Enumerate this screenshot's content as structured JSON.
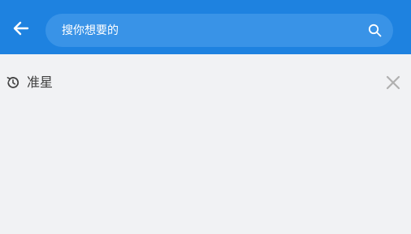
{
  "colors": {
    "header_bg": "#1e82e0",
    "search_bg": "#3993e7",
    "page_bg": "#f1f2f4",
    "text": "#3d3d3d",
    "icon_gray": "#b0b0b0"
  },
  "header": {
    "back_icon": "arrow-left-icon",
    "search": {
      "placeholder": "搜你想要的",
      "value": "",
      "icon": "search-icon"
    }
  },
  "history": {
    "icon": "history-icon",
    "items": [
      {
        "label": "准星"
      }
    ],
    "clear_icon": "close-icon"
  }
}
